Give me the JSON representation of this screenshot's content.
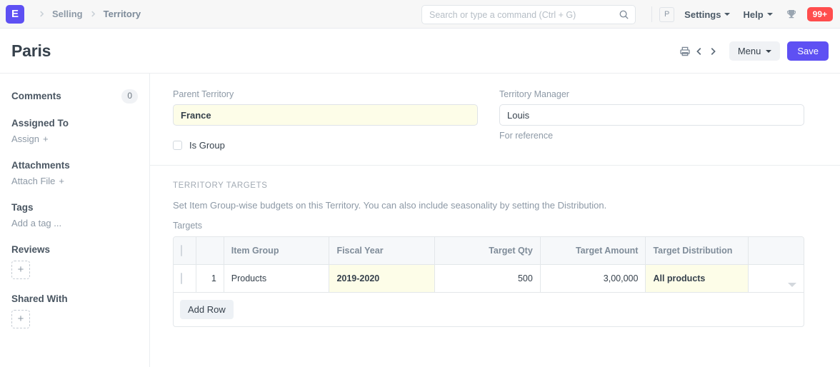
{
  "navbar": {
    "logo_letter": "E",
    "breadcrumbs": [
      {
        "label": "Selling"
      },
      {
        "label": "Territory"
      }
    ],
    "search": {
      "placeholder": "Search or type a command (Ctrl + G)",
      "value": ""
    },
    "avatar_letter": "P",
    "settings_label": "Settings",
    "help_label": "Help",
    "notification_count": "99+",
    "accent_color": "#5e50f3",
    "notification_color": "#ff4d4d"
  },
  "page": {
    "title": "Paris",
    "menu_label": "Menu",
    "save_label": "Save"
  },
  "sidebar": {
    "comments": {
      "label": "Comments",
      "count": "0"
    },
    "assigned_to": {
      "label": "Assigned To",
      "action": "Assign"
    },
    "attachments": {
      "label": "Attachments",
      "action": "Attach File"
    },
    "tags": {
      "label": "Tags",
      "action": "Add a tag ..."
    },
    "reviews": {
      "label": "Reviews",
      "add": "+"
    },
    "shared_with": {
      "label": "Shared With",
      "add": "+"
    }
  },
  "form": {
    "parent_territory": {
      "label": "Parent Territory",
      "value": "France"
    },
    "territory_manager": {
      "label": "Territory Manager",
      "value": "Louis",
      "help": "For reference"
    },
    "is_group": {
      "label": "Is Group",
      "checked": false
    }
  },
  "targets_section": {
    "heading": "TERRITORY TARGETS",
    "description": "Set Item Group-wise budgets on this Territory. You can also include seasonality by setting the Distribution.",
    "grid_label": "Targets",
    "columns": [
      "Item Group",
      "Fiscal Year",
      "Target Qty",
      "Target Amount",
      "Target Distribution"
    ],
    "rows": [
      {
        "index": "1",
        "item_group": "Products",
        "fiscal_year": "2019-2020",
        "target_qty": "500",
        "target_amount": "3,00,000",
        "target_distribution": "All products"
      }
    ],
    "add_row_label": "Add Row"
  }
}
